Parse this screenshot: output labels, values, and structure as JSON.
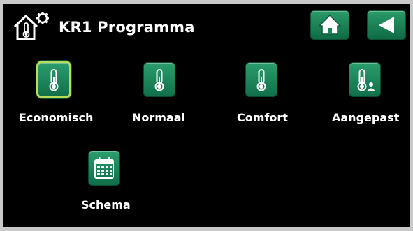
{
  "header": {
    "title": "KR1 Programma",
    "title_icon": "house-thermometer-gear-icon",
    "home_icon": "home-icon",
    "back_icon": "back-arrow-icon"
  },
  "options": [
    {
      "label": "Economisch",
      "icon": "thermometer-icon",
      "selected": true
    },
    {
      "label": "Normaal",
      "icon": "thermometer-icon",
      "selected": false
    },
    {
      "label": "Comfort",
      "icon": "thermometer-icon",
      "selected": false
    },
    {
      "label": "Aangepast",
      "icon": "thermometer-user-icon",
      "selected": false
    }
  ],
  "schedule": {
    "label": "Schema",
    "icon": "calendar-icon"
  },
  "colors": {
    "accent_green": "#1b855a",
    "selected_outline": "#b7dc5a",
    "background": "#000000",
    "text": "#ffffff"
  }
}
